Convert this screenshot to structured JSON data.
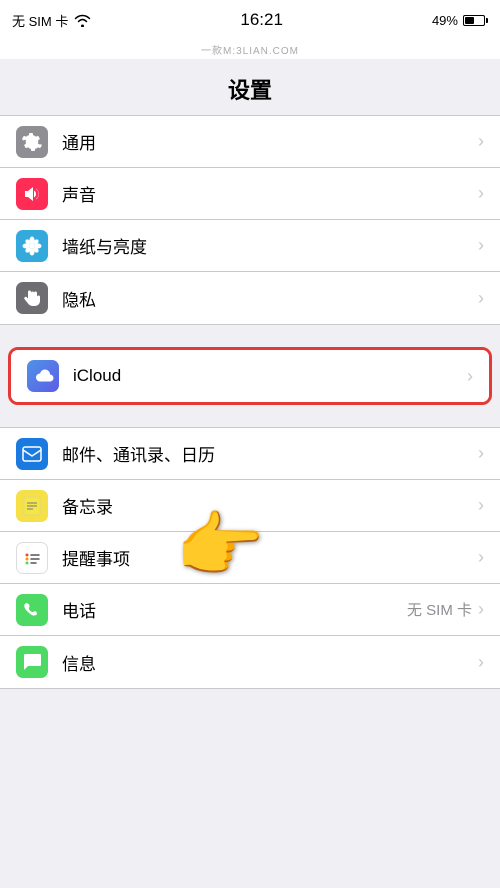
{
  "statusBar": {
    "carrier": "无 SIM 卡",
    "wifi": "WiFi",
    "time": "16:21",
    "battery": "49%"
  },
  "watermark": "一款M:3LIAN.COM",
  "pageTitle": "设置",
  "sections": [
    {
      "id": "general-section",
      "rows": [
        {
          "id": "general",
          "label": "通用",
          "iconBg": "gray",
          "iconType": "gear"
        },
        {
          "id": "sound",
          "label": "声音",
          "iconBg": "pink",
          "iconType": "sound"
        },
        {
          "id": "wallpaper",
          "label": "墙纸与亮度",
          "iconBg": "blue-light",
          "iconType": "flower"
        },
        {
          "id": "privacy",
          "label": "隐私",
          "iconBg": "dark-gray",
          "iconType": "hand"
        }
      ]
    },
    {
      "id": "icloud-section",
      "highlighted": true,
      "rows": [
        {
          "id": "icloud",
          "label": "iCloud",
          "iconBg": "icloud",
          "iconType": "icloud"
        }
      ]
    },
    {
      "id": "apps-section",
      "rows": [
        {
          "id": "mail",
          "label": "邮件、通讯录、日历",
          "iconBg": "mail",
          "iconType": "mail"
        },
        {
          "id": "notes",
          "label": "备忘录",
          "iconBg": "notes",
          "iconType": "notes"
        },
        {
          "id": "reminders",
          "label": "提醒事项",
          "iconBg": "reminders",
          "iconType": "reminders"
        },
        {
          "id": "phone",
          "label": "电话",
          "sublabel": "无 SIM 卡",
          "iconBg": "phone",
          "iconType": "phone"
        },
        {
          "id": "messages",
          "label": "信息",
          "iconBg": "messages",
          "iconType": "messages"
        }
      ]
    }
  ]
}
